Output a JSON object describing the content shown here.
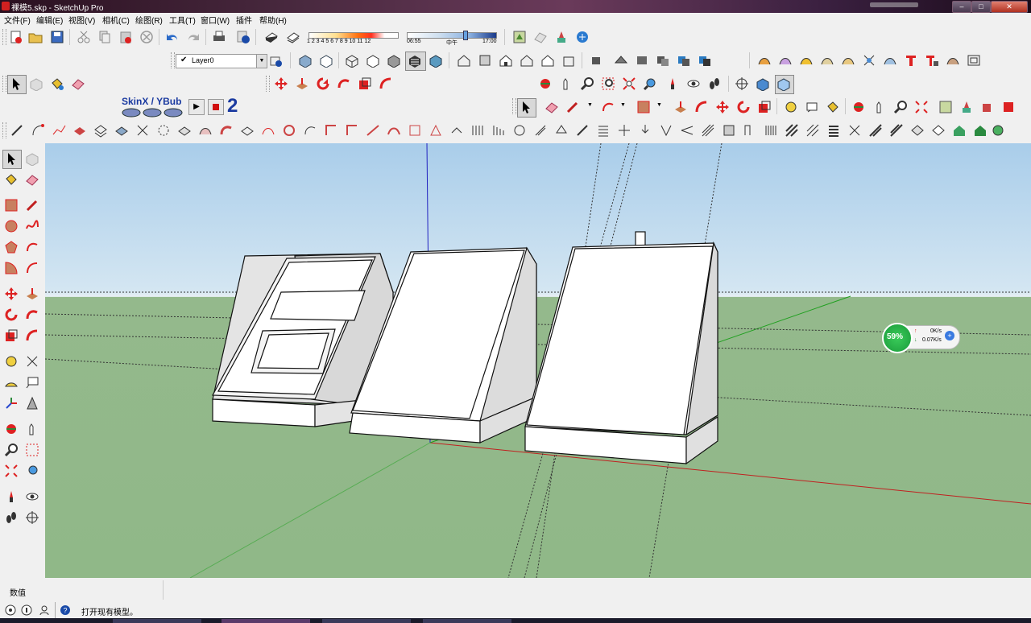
{
  "window": {
    "title": "裸模5.skp - SketchUp Pro"
  },
  "menu": [
    "文件(F)",
    "编辑(E)",
    "视图(V)",
    "相机(C)",
    "绘图(R)",
    "工具(T)",
    "窗口(W)",
    "插件",
    "帮助(H)"
  ],
  "shadow": {
    "months": "1 2 3 4 5 6 7 8 9 10 11 12",
    "time_start": "06:55",
    "time_mid": "中午",
    "time_end": "17:00"
  },
  "layer": {
    "current": "Layer0",
    "check": "✔"
  },
  "plugin": {
    "skin_label": "SkinX / YBub"
  },
  "network": {
    "percent": "59%",
    "up": "0K/s",
    "down": "0.07K/s"
  },
  "value_bar": {
    "label": "数值"
  },
  "status": {
    "message": "打开现有模型。"
  },
  "colors": {
    "sky_top": "#a9cdea",
    "ground": "#90b888",
    "accent_red": "#cc1010"
  }
}
